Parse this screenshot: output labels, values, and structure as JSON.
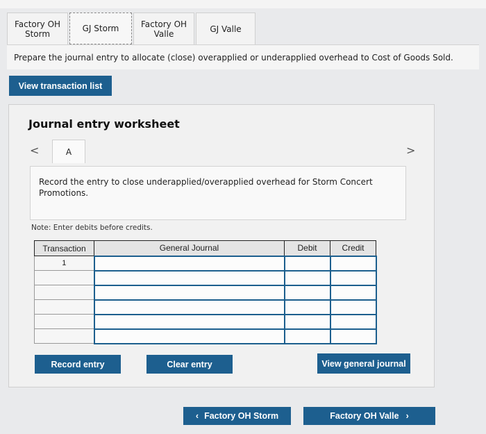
{
  "tabs": [
    {
      "label": "Factory OH\nStorm",
      "active": false
    },
    {
      "label": "GJ Storm",
      "active": true
    },
    {
      "label": "Factory OH\nValle",
      "active": false
    },
    {
      "label": "GJ Valle",
      "active": false
    }
  ],
  "instruction": "Prepare the journal entry to allocate (close) overapplied or underapplied overhead to Cost of Goods Sold.",
  "view_transactions_label": "View transaction list",
  "worksheet": {
    "title": "Journal entry worksheet",
    "prev_arrow": "<",
    "next_arrow": ">",
    "subtab": "A",
    "description": "Record the entry to close underapplied/overapplied overhead for Storm Concert Promotions.",
    "note": "Note: Enter debits before credits.",
    "table": {
      "headers": [
        "Transaction",
        "General Journal",
        "Debit",
        "Credit"
      ],
      "first_transaction": "1"
    },
    "record_label": "Record entry",
    "clear_label": "Clear entry",
    "view_journal_label": "View general journal"
  },
  "bottom_nav": {
    "prev_label": "Factory OH Storm",
    "next_label": "Factory OH Valle"
  },
  "colors": {
    "accent": "#1d5f8f"
  }
}
